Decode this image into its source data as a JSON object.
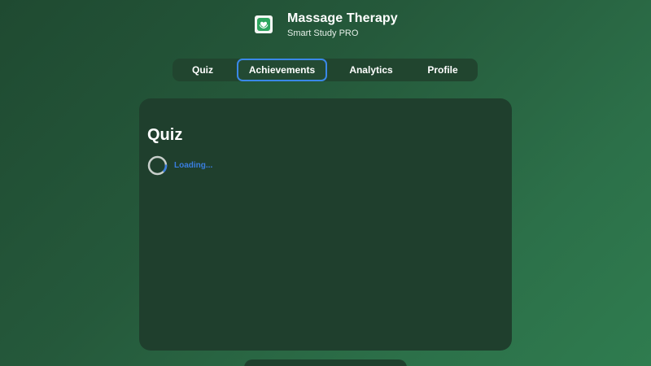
{
  "app": {
    "title": "Massage Therapy",
    "subtitle": "Smart Study PRO",
    "logo_icon": "heart-hands-icon"
  },
  "nav": {
    "active": "Achievements",
    "tabs": [
      {
        "label": "Quiz"
      },
      {
        "label": "Achievements"
      },
      {
        "label": "Analytics"
      },
      {
        "label": "Profile"
      }
    ]
  },
  "main": {
    "title": "Quiz",
    "loading_text": "Loading..."
  },
  "colors": {
    "accent": "#3a88e8",
    "card_bg": "#1f3f2d",
    "logo_green": "#2ea55f"
  }
}
